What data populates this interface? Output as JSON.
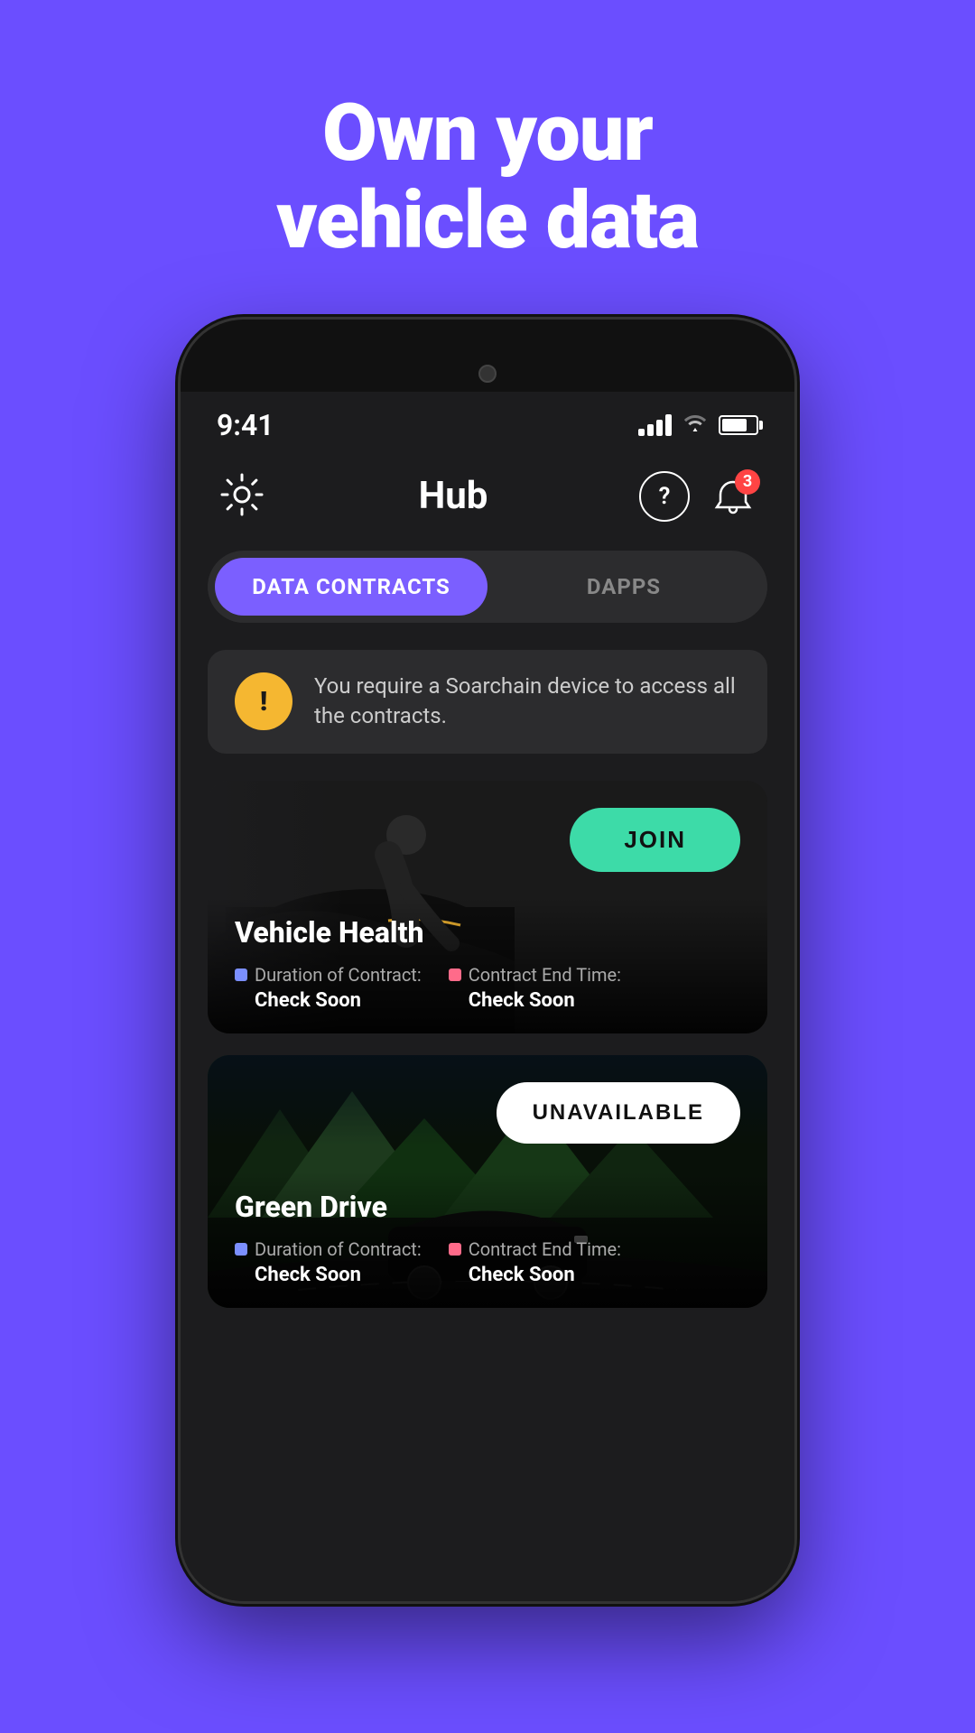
{
  "hero": {
    "line1": "Own your",
    "line2": "vehicle data"
  },
  "statusBar": {
    "time": "9:41",
    "signalBars": [
      8,
      12,
      16,
      20
    ],
    "batteryPercent": 75,
    "notificationCount": "3"
  },
  "appHeader": {
    "title": "Hub",
    "notificationBadge": "3"
  },
  "tabs": [
    {
      "label": "DATA CONTRACTS",
      "active": true
    },
    {
      "label": "DAPPS",
      "active": false
    }
  ],
  "warning": {
    "icon": "!",
    "text": "You require a Soarchain device to access all the contracts."
  },
  "contracts": [
    {
      "title": "Vehicle Health",
      "joinLabel": "JOIN",
      "joinType": "primary",
      "durationLabel": "Duration of Contract:",
      "durationValue": "Check Soon",
      "endTimeLabel": "Contract End Time:",
      "endTimeValue": "Check Soon"
    },
    {
      "title": "Green Drive",
      "joinLabel": "UNAVAILABLE",
      "joinType": "secondary",
      "durationLabel": "Duration of Contract:",
      "durationValue": "Check Soon",
      "endTimeLabel": "Contract End Time:",
      "endTimeValue": "Check Soon"
    }
  ],
  "colors": {
    "background": "#6B4EFF",
    "accent": "#7B5FFF",
    "joinGreen": "#3DDBA8",
    "unavailableWhite": "#FFFFFF"
  }
}
